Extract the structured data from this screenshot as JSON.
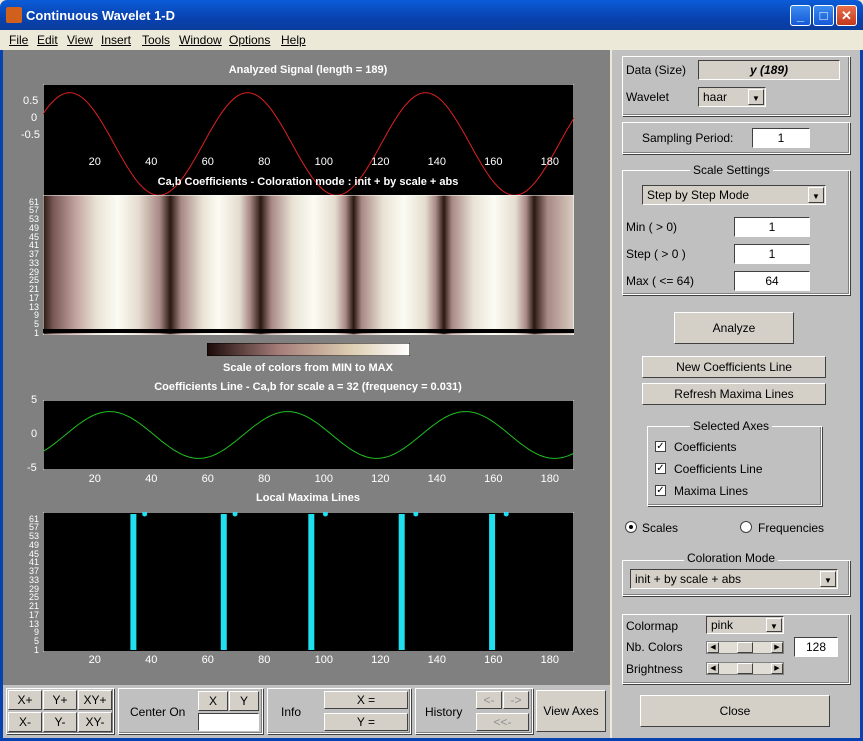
{
  "window": {
    "title": "Continuous Wavelet 1-D"
  },
  "menu": [
    "File",
    "Edit",
    "View",
    "Insert",
    "Tools",
    "Window",
    "Options",
    "Help"
  ],
  "plots": {
    "signal": {
      "title": "Analyzed Signal  (length = 189)",
      "yticks": [
        "0.5",
        "0",
        "-0.5"
      ],
      "xticks": [
        "20",
        "40",
        "60",
        "80",
        "100",
        "120",
        "140",
        "160",
        "180"
      ],
      "color": "#e02020"
    },
    "coefs": {
      "title": "Ca,b Coefficients  - Coloration mode : init + by scale + abs",
      "yticks": [
        "61",
        "57",
        "53",
        "49",
        "45",
        "41",
        "37",
        "33",
        "29",
        "25",
        "21",
        "17",
        "13",
        "9",
        "5",
        "1"
      ]
    },
    "colorbar": {
      "label": "Scale of colors from MIN to MAX"
    },
    "coefline": {
      "title": "Coefficients Line - Ca,b   for scale a = 32  (frequency =   0.031)",
      "yticks": [
        "5",
        "0",
        "-5"
      ],
      "xticks": [
        "20",
        "40",
        "60",
        "80",
        "100",
        "120",
        "140",
        "160",
        "180"
      ],
      "color": "#20c020"
    },
    "maxima": {
      "title": "Local Maxima Lines",
      "yticks": [
        "61",
        "57",
        "53",
        "49",
        "45",
        "41",
        "37",
        "33",
        "29",
        "25",
        "21",
        "17",
        "13",
        "9",
        "5",
        "1"
      ],
      "xticks": [
        "20",
        "40",
        "60",
        "80",
        "100",
        "120",
        "140",
        "160",
        "180"
      ],
      "color": "#20e0f0"
    }
  },
  "panel": {
    "data_label": "Data  (Size)",
    "data_value": "y  (189)",
    "wavelet_label": "Wavelet",
    "wavelet_value": "haar",
    "sampling_label": "Sampling Period:",
    "sampling_value": "1",
    "scale_settings_title": "Scale Settings",
    "scale_mode": "Step by Step Mode",
    "min_label": "Min  ( > 0)",
    "min_value": "1",
    "step_label": "Step ( > 0 )",
    "step_value": "1",
    "max_label": "Max  ( <= 64)",
    "max_value": "64",
    "analyze": "Analyze",
    "new_coef_line": "New Coefficients Line",
    "refresh_maxima": "Refresh Maxima Lines",
    "selected_axes_title": "Selected Axes",
    "chk_coefficients": "Coefficients",
    "chk_coef_line": "Coefficients Line",
    "chk_maxima": "Maxima Lines",
    "radio_scales": "Scales",
    "radio_frequencies": "Frequencies",
    "coloration_title": "Coloration Mode",
    "coloration_value": "init + by scale + abs",
    "colormap_label": "Colormap",
    "colormap_value": "pink",
    "nbcolors_label": "Nb. Colors",
    "nbcolors_value": "128",
    "brightness_label": "Brightness",
    "close": "Close"
  },
  "bottom": {
    "xplus": "X+",
    "yplus": "Y+",
    "xyplus": "XY+",
    "xminus": "X-",
    "yminus": "Y-",
    "xyminus": "XY-",
    "center_on": "Center On",
    "cx": "X",
    "cy": "Y",
    "info": "Info",
    "xeq": "X =",
    "yeq": "Y =",
    "history": "History",
    "hist_left": "<-",
    "hist_right": "->",
    "hist_back": "<<-",
    "view_axes": "View Axes"
  }
}
